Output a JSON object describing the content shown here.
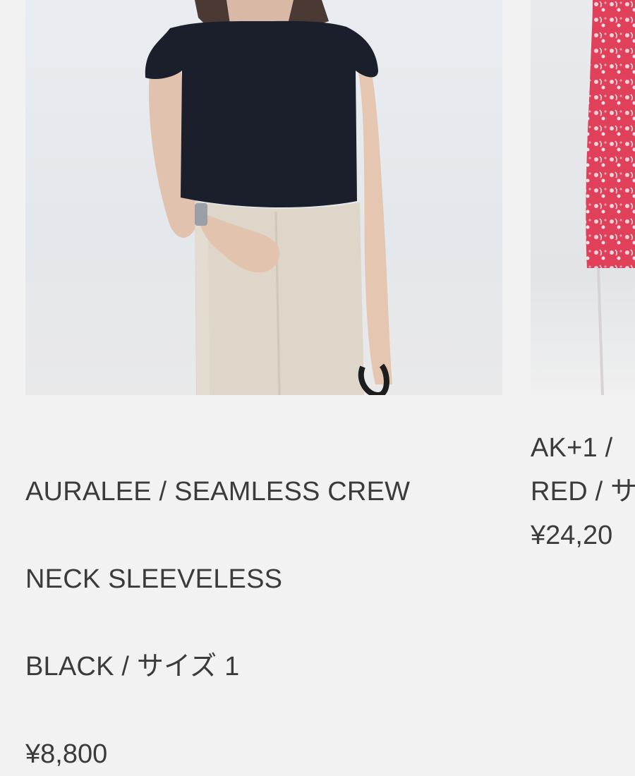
{
  "products": [
    {
      "title_lines": [
        "AURALEE / SEAMLESS CREW",
        "NECK SLEEVELESS",
        "BLACK / サイズ 1"
      ],
      "price": "¥8,800",
      "image": {
        "subject": "product-photo-black-sleeveless-top"
      }
    },
    {
      "title_lines": [
        "AK+1 / ",
        "RED / サ"
      ],
      "price": "¥24,20",
      "image": {
        "subject": "product-photo-red-floral"
      }
    }
  ],
  "colors": {
    "background": "#f2f2f2",
    "text": "#3b3b3b",
    "top": "#1b1f2c",
    "pants": "#ddd6c9",
    "red": "#e0405a"
  }
}
